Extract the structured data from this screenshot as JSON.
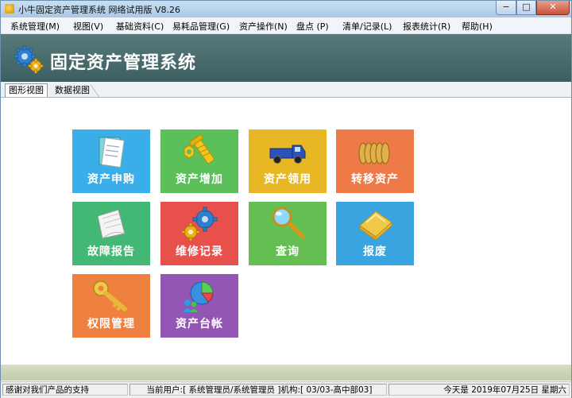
{
  "window": {
    "title": "小牛固定资产管理系统 网络试用版 V8.26",
    "minimize_symbol": "−",
    "maximize_symbol": "□",
    "close_symbol": "✕"
  },
  "menubar": {
    "items": [
      {
        "label": "系统管理(M)"
      },
      {
        "label": "视图(V)"
      },
      {
        "label": "基础资料(C)"
      },
      {
        "label": "易耗品管理(G)"
      },
      {
        "label": "资产操作(N)"
      },
      {
        "label": "盘点 (P)"
      },
      {
        "label": "清单/记录(L)"
      },
      {
        "label": "报表统计(R)"
      },
      {
        "label": "帮助(H)"
      }
    ]
  },
  "banner": {
    "title": "固定资产管理系统",
    "icon": "gears-icon"
  },
  "tabs": [
    {
      "label": "图形视图",
      "active": true
    },
    {
      "label": "数据视图",
      "active": false
    }
  ],
  "tiles": [
    {
      "label": "资产申购",
      "icon": "document-icon",
      "color": "#3aaee8"
    },
    {
      "label": "资产增加",
      "icon": "bolt-nut-icon",
      "color": "#5cc05a"
    },
    {
      "label": "资产领用",
      "icon": "truck-icon",
      "color": "#e8b824"
    },
    {
      "label": "转移资产",
      "icon": "coins-icon",
      "color": "#ee7a48"
    },
    {
      "label": "故障报告",
      "icon": "paper-icon",
      "color": "#42b874"
    },
    {
      "label": "维修记录",
      "icon": "gears-icon",
      "color": "#e8504c"
    },
    {
      "label": "查询",
      "icon": "magnifier-icon",
      "color": "#64be52"
    },
    {
      "label": "报废",
      "icon": "folder-icon",
      "color": "#3aa4e0"
    },
    {
      "label": "权限管理",
      "icon": "key-icon",
      "color": "#ee8040"
    },
    {
      "label": "资产台帐",
      "icon": "pie-chart-icon",
      "color": "#9456b4"
    }
  ],
  "statusbar": {
    "message": "感谢对我们产品的支持",
    "user_info": "当前用户:[ 系统管理员/系统管理员 ]机构:[ 03/03-高中部03]",
    "date_info": "今天是 2019年07月25日 星期六"
  }
}
